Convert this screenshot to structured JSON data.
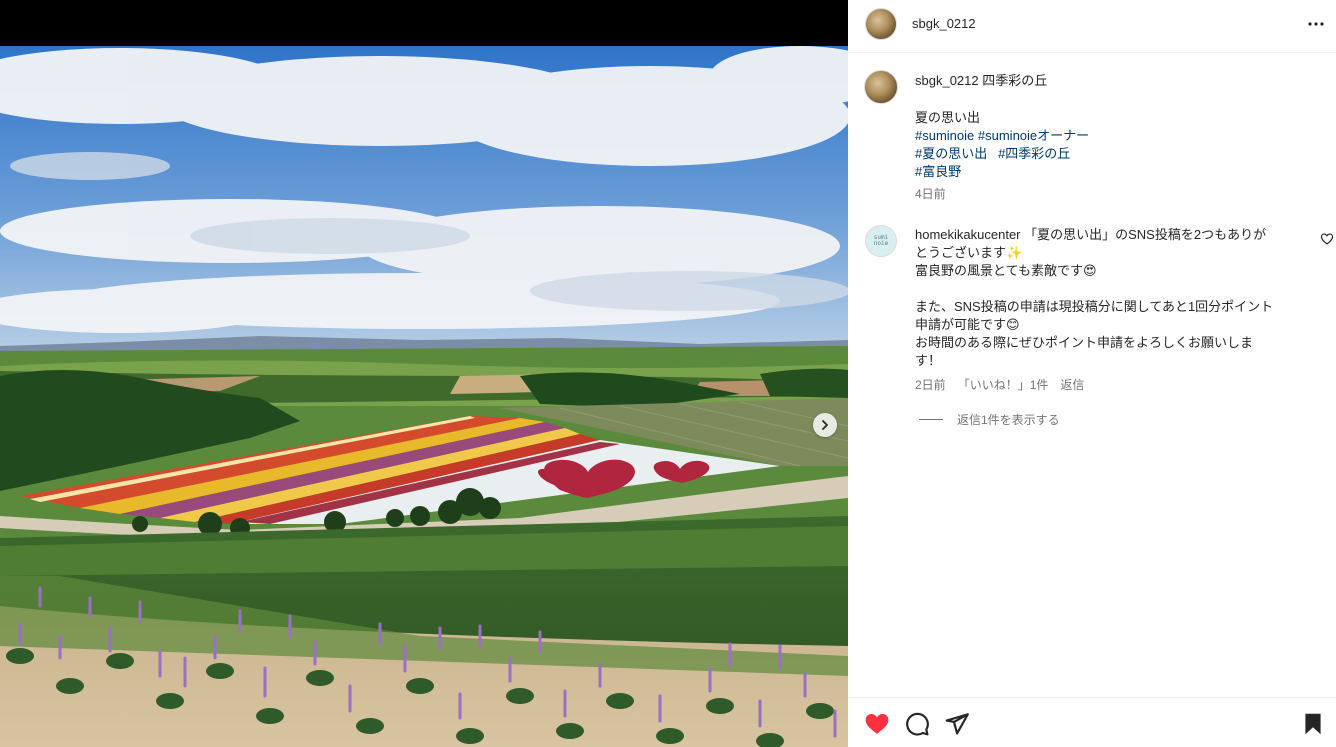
{
  "post": {
    "username": "sbgk_0212",
    "caption_title": "四季彩の丘",
    "caption_lines": [
      "夏の思い出"
    ],
    "hashtags_line1": [
      "#suminoie",
      "#suminoieオーナー"
    ],
    "hashtags_line2": [
      "#夏の思い出",
      "#四季彩の丘"
    ],
    "hashtags_line3": [
      "#富良野"
    ],
    "time": "4日前"
  },
  "comment": {
    "avatar_text_top": "sumi",
    "avatar_text_bottom": "noie",
    "username": "homekikakucenter",
    "line1": "「夏の思い出」のSNS投稿を2つもありが",
    "line2": "とうございます✨",
    "line3": "富良野の風景とても素敵です😍",
    "line4": "また、SNS投稿の申請は現投稿分に関してあと1回分ポイント",
    "line5": "申請が可能です😊",
    "line6": "お時間のある際にぜひポイント申請をよろしくお願いしま",
    "line7": "す！",
    "time": "2日前",
    "likes": "「いいね！」1件",
    "reply_label": "返信",
    "view_replies": "返信1件を表示する"
  },
  "icons": {
    "next": "chevron-right-icon",
    "more": "more-horizontal-icon",
    "comment_like": "heart-outline-icon",
    "like": "heart-filled-icon",
    "comment": "speech-bubble-icon",
    "share": "paper-plane-icon",
    "save": "bookmark-filled-icon"
  },
  "colors": {
    "like_red": "#ff3040",
    "hashtag_blue": "#00376b",
    "meta_gray": "#737373"
  }
}
